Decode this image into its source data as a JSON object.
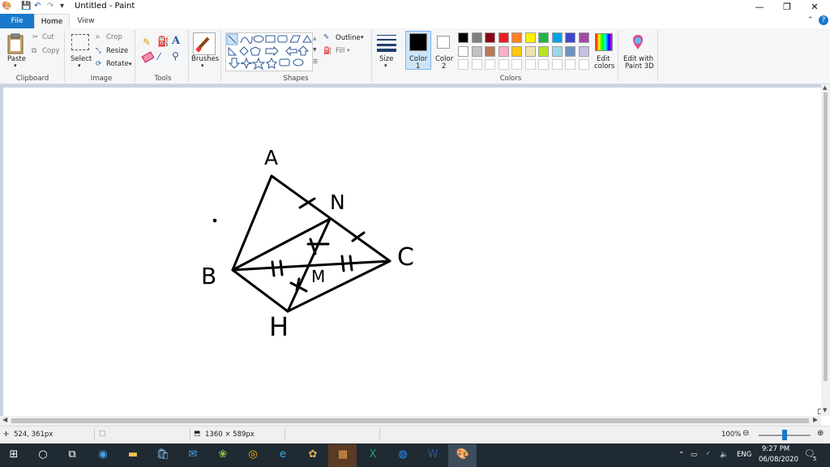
{
  "window": {
    "title": "Untitled - Paint"
  },
  "tabs": [
    "File",
    "Home",
    "View"
  ],
  "ribbon": {
    "clipboard": {
      "paste": "Paste",
      "cut": "Cut",
      "copy": "Copy",
      "group": "Clipboard"
    },
    "image": {
      "select": "Select",
      "crop": "Crop",
      "resize": "Resize",
      "rotate": "Rotate",
      "group": "Image"
    },
    "tools": {
      "group": "Tools"
    },
    "brushes": {
      "label": "Brushes"
    },
    "shapes": {
      "outline": "Outline",
      "fill": "Fill",
      "group": "Shapes"
    },
    "size": {
      "label": "Size"
    },
    "color1": {
      "label": "Color",
      "num": "1"
    },
    "color2": {
      "label": "Color",
      "num": "2"
    },
    "colors": {
      "group": "Colors",
      "edit_line1": "Edit",
      "edit_line2": "colors",
      "paint3d_line1": "Edit with",
      "paint3d_line2": "Paint 3D"
    },
    "palette_row1": [
      "#000000",
      "#7f7f7f",
      "#880015",
      "#ed1c24",
      "#ff7f27",
      "#fff200",
      "#22b14c",
      "#00a2e8",
      "#3f48cc",
      "#a349a4"
    ],
    "palette_row2": [
      "#ffffff",
      "#c3c3c3",
      "#b97a57",
      "#ffaec9",
      "#ffc90e",
      "#efe4b0",
      "#b5e61d",
      "#99d9ea",
      "#7092be",
      "#c8bfe7"
    ]
  },
  "drawing": {
    "labels": [
      "A",
      "N",
      "B",
      "C",
      "M",
      "H"
    ]
  },
  "status": {
    "cursor_pos": "524, 361px",
    "image_size": "1360 × 589px",
    "zoom": "100%"
  },
  "taskbar": {
    "lang": "ENG",
    "time": "9:27 PM",
    "date": "06/08/2020",
    "notifications": "5"
  }
}
